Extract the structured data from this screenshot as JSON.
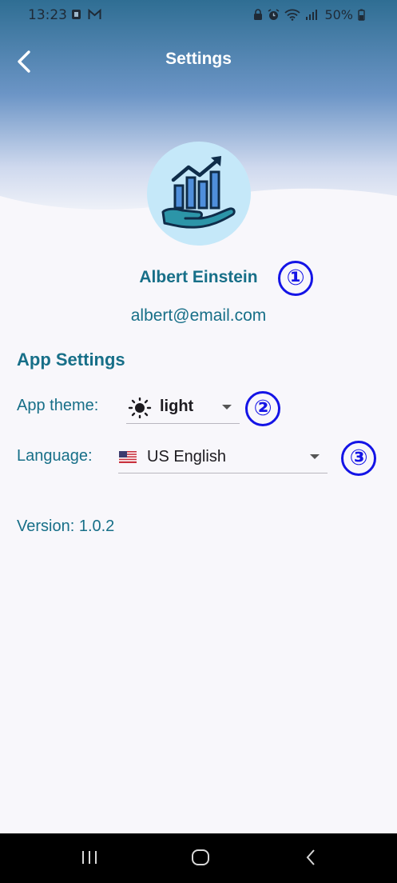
{
  "status_bar": {
    "time": "13:23",
    "battery": "50%"
  },
  "header": {
    "title": "Settings"
  },
  "profile": {
    "name": "Albert Einstein",
    "email": "albert@email.com"
  },
  "markers": [
    "①",
    "②",
    "③"
  ],
  "app_settings": {
    "section_title": "App Settings",
    "theme": {
      "label": "App theme:",
      "value": "light",
      "icon": "sun-icon"
    },
    "language": {
      "label": "Language:",
      "value": "US English",
      "icon": "us-flag-icon"
    }
  },
  "version": "Version: 1.0.2",
  "colors": {
    "accent": "#176f88",
    "header_top": "#2e6f94",
    "avatar_bg": "#c5e8f9",
    "marker": "#1414e6"
  }
}
